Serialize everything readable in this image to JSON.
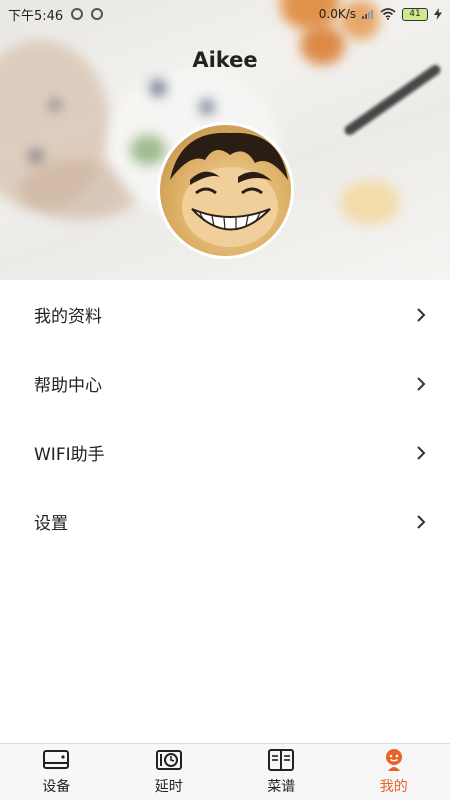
{
  "status_bar": {
    "time": "下午5:46",
    "network_speed": "0.0K/s",
    "battery": "41"
  },
  "profile": {
    "username": "Aikee"
  },
  "menu": {
    "items": [
      {
        "label": "我的资料"
      },
      {
        "label": "帮助中心"
      },
      {
        "label": "WIFI助手"
      },
      {
        "label": "设置"
      }
    ]
  },
  "tabbar": {
    "tabs": [
      {
        "label": "设备",
        "icon": "device-icon"
      },
      {
        "label": "延时",
        "icon": "timer-icon"
      },
      {
        "label": "菜谱",
        "icon": "recipe-book-icon"
      },
      {
        "label": "我的",
        "icon": "profile-icon",
        "active": true
      }
    ],
    "active_color": "#e8622a"
  }
}
